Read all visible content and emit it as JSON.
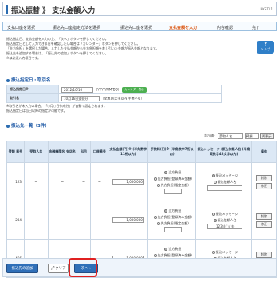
{
  "header": {
    "title": "振込振替 》 支払金額入力",
    "screen_code": "BKST11"
  },
  "steps": [
    "支払口座を選択",
    "振込先口座指定方法を選択",
    "振込先口座を選択",
    "支払金額を入力",
    "内容確認",
    "完了"
  ],
  "help": {
    "label": "ヘルプ"
  },
  "intro": [
    "振込指定日、支払金額を入力の上、「次へ」ボタンを押してください。",
    "振込指定日として入力できる日を確認したい場合は「カレンダー」ボタンを押してください。",
    "「先方負担」を選択した場合、入力した支払金額から先方負担額を差し引いた金額が振込金額となります。",
    "振込先を追加する場合は、「振込先の追加」ボタンを押してください。",
    "※は必須入力項目です。"
  ],
  "info_section": {
    "heading": "振込指定日・取引名",
    "date_label": "振込指定日※",
    "date_value": "2012/10/16",
    "date_format": "（YYYY/MM/DD）",
    "calendar_label": "カレンダー表示",
    "name_label": "取引名",
    "name_value": "10月16日支払分",
    "name_hint": "（全角10文字以内 半角不可）"
  },
  "notes": [
    "※取引名が未入力の場合、「○月○日作成分」が自動で設定されます。",
    "振込指定日は当日以降の指定が可能です。"
  ],
  "dest_section": {
    "heading": "振込先一覧（3件）"
  },
  "sort": {
    "label": "並び順：",
    "value": "受取人名",
    "order": "昇順",
    "button": "再表示"
  },
  "table": {
    "headers": [
      "登録 番号",
      "受取人名",
      "金融機関名 支店名",
      "科目",
      "口座番号",
      "支払金額(円)※ (半角数字11桁以内)",
      "手数料(円)※ (半角数字7桁以内)",
      "振込メッセージ /振込依頼人名 (半角英数字48文字以内)",
      "操作"
    ],
    "fee_options": [
      "当方負担",
      "先方負担(登録済み金額)",
      "先方負担(指定金額)"
    ],
    "msg_options": [
      "振込メッセージ",
      "振込依頼人名"
    ],
    "op_buttons": [
      "削除",
      "修正"
    ],
    "rows": [
      {
        "reg_no": "123",
        "payee": "－",
        "bank": "－",
        "type": "－",
        "account": "－",
        "amount": "1,000,000",
        "fee_selected": 0,
        "msg_selected": 0,
        "message": ""
      },
      {
        "reg_no": "234",
        "payee": "－",
        "bank": "－",
        "type": "－",
        "account": "－",
        "amount": "1,000,000",
        "fee_selected": 0,
        "msg_selected": 1,
        "message": "123ｶ)ﾃﾞｼﾞﾀﾙ"
      },
      {
        "reg_no": "456",
        "payee": "－",
        "bank": "－",
        "type": "－",
        "account": "－",
        "amount": "1,000,000",
        "fee_selected": 0,
        "msg_selected": 1,
        "message": "ｶ)ﾃﾞｼﾞﾀﾙ"
      }
    ]
  },
  "footer": {
    "add_button": "振込先の追加",
    "clear_button": "クリア",
    "next_button": "次へ"
  },
  "colors": {
    "accent": "#2f6fb8",
    "highlight": "#e02020",
    "active_step": "#d94a00"
  }
}
